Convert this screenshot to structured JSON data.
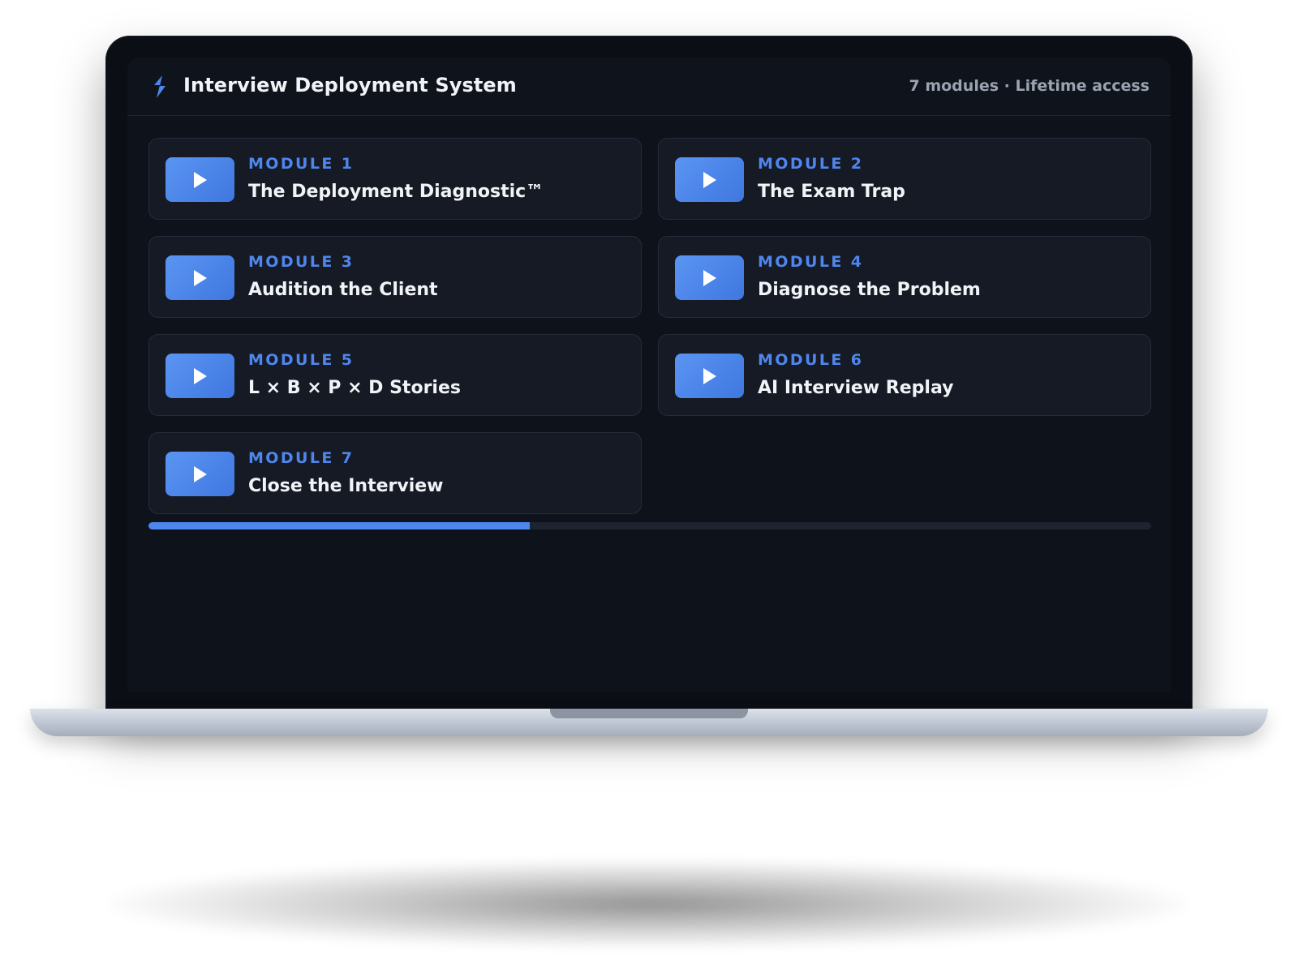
{
  "app": {
    "title": "Interview Deployment System",
    "meta": "7 modules · Lifetime access",
    "brand_icon": "bolt-icon"
  },
  "modules": [
    {
      "number_label": "MODULE 1",
      "title": "The Deployment Diagnostic™"
    },
    {
      "number_label": "MODULE 2",
      "title": "The Exam Trap"
    },
    {
      "number_label": "MODULE 3",
      "title": "Audition the Client"
    },
    {
      "number_label": "MODULE 4",
      "title": "Diagnose the Problem"
    },
    {
      "number_label": "MODULE 5",
      "title": "L × B × P × D Stories"
    },
    {
      "number_label": "MODULE 6",
      "title": "AI Interview Replay"
    },
    {
      "number_label": "MODULE 7",
      "title": "Close the Interview"
    }
  ],
  "progress": {
    "fraction": 0.38
  },
  "colors": {
    "accent": "#4f86ee",
    "screen_bg": "#0e121b",
    "card_bg": "#151a25",
    "text_primary": "#f1f3f7",
    "text_muted": "#9aa3b1"
  }
}
